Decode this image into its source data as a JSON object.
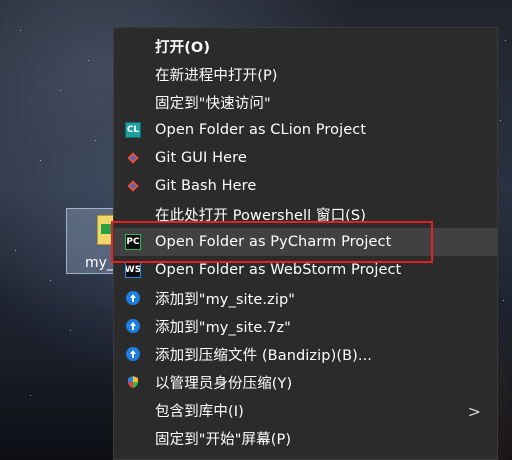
{
  "desktop_icon": {
    "label": "my_"
  },
  "menu": {
    "items": [
      {
        "label": "打开(O)",
        "icon": "none",
        "bold": true
      },
      {
        "label": "在新进程中打开(P)",
        "icon": "none"
      },
      {
        "label": "固定到\"快速访问\"",
        "icon": "none"
      },
      {
        "label": "Open Folder as CLion Project",
        "icon": "clion-icon",
        "icon_text": "CL"
      },
      {
        "label": "Git GUI Here",
        "icon": "git-icon"
      },
      {
        "label": "Git Bash Here",
        "icon": "git-icon"
      },
      {
        "label": "在此处打开 Powershell 窗口(S)",
        "icon": "none"
      },
      {
        "label": "Open Folder as PyCharm Project",
        "icon": "pycharm-icon",
        "icon_text": "PC",
        "hovered": true
      },
      {
        "label": "Open Folder as WebStorm Project",
        "icon": "webstorm-icon",
        "icon_text": "WS"
      },
      {
        "label": "添加到\"my_site.zip\"",
        "icon": "bandizip-icon"
      },
      {
        "label": "添加到\"my_site.7z\"",
        "icon": "bandizip-icon"
      },
      {
        "label": "添加到压缩文件 (Bandizip)(B)...",
        "icon": "bandizip-icon"
      },
      {
        "label": "以管理员身份压缩(Y)",
        "icon": "shield-icon"
      },
      {
        "label": "包含到库中(I)",
        "icon": "none",
        "submenu": ">"
      },
      {
        "label": "固定到\"开始\"屏幕(P)",
        "icon": "none"
      }
    ]
  },
  "colors": {
    "menu_bg": "#2b2b2b",
    "hover_bg": "#414141",
    "highlight_border": "#e02222"
  }
}
